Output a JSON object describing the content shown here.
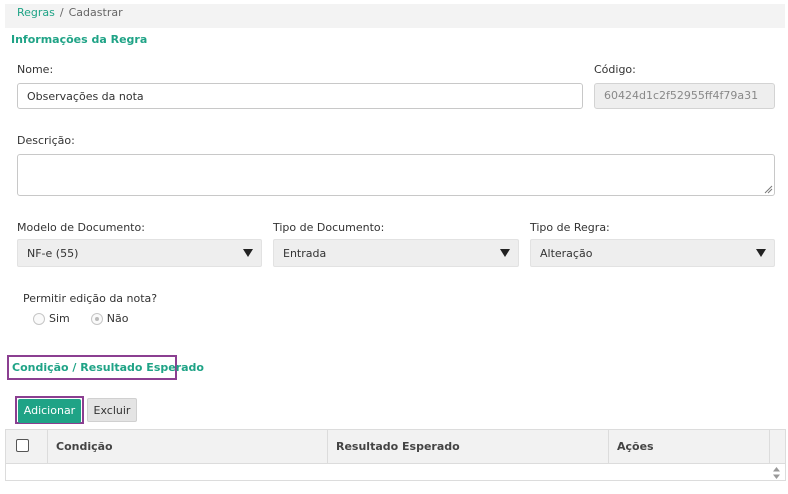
{
  "breadcrumb": {
    "root": "Regras",
    "separator": "/",
    "current": "Cadastrar"
  },
  "sections": {
    "info_title": "Informações da Regra",
    "condition_title": "Condição / Resultado Esperado"
  },
  "form": {
    "nome_label": "Nome:",
    "nome_value": "Observações da nota",
    "codigo_label": "Código:",
    "codigo_value": "60424d1c2f52955ff4f79a31",
    "descricao_label": "Descrição:",
    "descricao_value": "",
    "modelo_label": "Modelo de Documento:",
    "modelo_value": "NF-e (55)",
    "tipo_doc_label": "Tipo de Documento:",
    "tipo_doc_value": "Entrada",
    "tipo_regra_label": "Tipo de Regra:",
    "tipo_regra_value": "Alteração",
    "permitir_label": "Permitir edição da nota?",
    "permitir_options": [
      "Sim",
      "Não"
    ],
    "permitir_selected": "Não"
  },
  "buttons": {
    "add": "Adicionar",
    "delete": "Excluir"
  },
  "grid": {
    "columns": [
      "Condição",
      "Resultado Esperado",
      "Ações"
    ]
  },
  "colors": {
    "accent": "#1fa386",
    "highlight": "#8b3f91"
  }
}
